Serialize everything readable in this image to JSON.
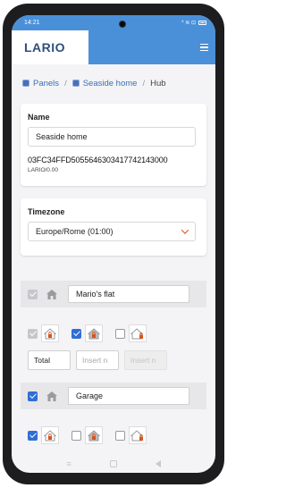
{
  "status_bar": {
    "time": "14:21",
    "icons": "* ≋ ⊡"
  },
  "header": {
    "logo": "LARIO"
  },
  "breadcrumb": {
    "items": [
      "Panels",
      "Seaside home",
      "Hub"
    ]
  },
  "name_card": {
    "label": "Name",
    "value": "Seaside home",
    "hub_id": "03FC34FFD5055646303417742143000",
    "hub_version": "LARIO/0.00"
  },
  "timezone_card": {
    "label": "Timezone",
    "selected": "Europe/Rome (01:00)"
  },
  "groups": [
    {
      "name": "Mario's flat",
      "checked": true,
      "disabled": true,
      "modes": [
        {
          "checked": true,
          "disabled": true,
          "icon": "house-lock-icon"
        },
        {
          "checked": true,
          "disabled": false,
          "icon": "house-filled-lock-icon"
        },
        {
          "checked": false,
          "disabled": false,
          "icon": "house-outline-lock-icon"
        }
      ],
      "inputs": [
        {
          "value": "Total"
        },
        {
          "placeholder": "Insert n"
        },
        {
          "placeholder": "Insert n"
        }
      ]
    },
    {
      "name": "Garage",
      "checked": true,
      "disabled": false,
      "modes": [
        {
          "checked": true,
          "disabled": false,
          "icon": "house-lock-icon"
        },
        {
          "checked": false,
          "disabled": false,
          "icon": "house-filled-lock-icon"
        },
        {
          "checked": false,
          "disabled": false,
          "icon": "house-outline-lock-icon"
        }
      ]
    }
  ],
  "colors": {
    "accent": "#4a90d9",
    "link": "#3b6fb6",
    "lock": "#d9531e",
    "checkbox": "#2f6ed6"
  }
}
